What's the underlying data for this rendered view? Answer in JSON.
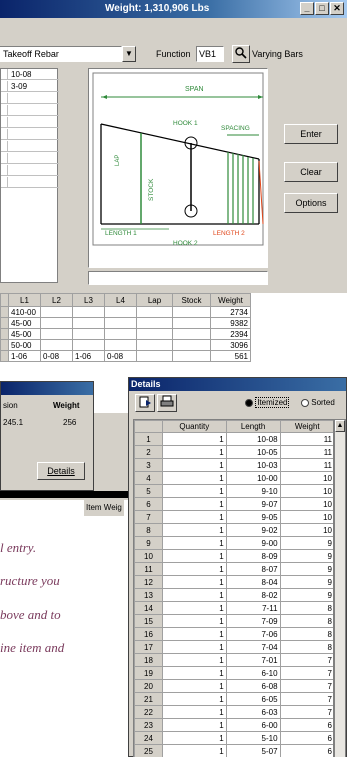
{
  "window": {
    "title": "Weight: 1,310,906 Lbs",
    "btn_min": "_",
    "btn_max": "□",
    "btn_close": "✕"
  },
  "toolbar": {
    "job_combo": "Takeoff Rebar",
    "function_label": "Function",
    "function_value": "VB1",
    "varying_label": "Varying Bars"
  },
  "left_list": [
    "10-08",
    "3-09",
    "",
    "",
    "",
    "",
    "",
    "",
    "",
    ""
  ],
  "diagram": {
    "span": "SPAN",
    "hook1": "HOOK 1",
    "hook2": "HOOK 2",
    "spacing": "SPACING",
    "lap": "LAP",
    "stock": "STOCK",
    "length1": "LENGTH 1",
    "length2": "LENGTH 2"
  },
  "side_buttons": {
    "enter": "Enter",
    "clear": "Clear",
    "options": "Options"
  },
  "grid": {
    "headers": [
      "L1",
      "L2",
      "L3",
      "L4",
      "Lap",
      "Stock",
      "Weight"
    ],
    "rows": [
      [
        "410-00",
        "",
        "",
        "",
        "",
        "",
        "2734"
      ],
      [
        "45-00",
        "",
        "",
        "",
        "",
        "",
        "9382"
      ],
      [
        "45-00",
        "",
        "",
        "",
        "",
        "",
        "2394"
      ],
      [
        "50-00",
        "",
        "",
        "",
        "",
        "",
        "3096"
      ],
      [
        "1-06",
        "0-08",
        "1-06",
        "0-08",
        "",
        "",
        "561"
      ]
    ]
  },
  "small_dialog": {
    "col1": "sion",
    "col2": "Weight",
    "val1": "245.1",
    "val2": "256",
    "details_button": "Details"
  },
  "item_weight_label": "Item Weig",
  "details": {
    "title": "Details",
    "radio_itemized": "Itemized",
    "radio_sorted": "Sorted",
    "headers": [
      "Quantity",
      "Length",
      "Weight"
    ],
    "rows": [
      [
        "1",
        "1",
        "10-08",
        "11"
      ],
      [
        "2",
        "1",
        "10-05",
        "11"
      ],
      [
        "3",
        "1",
        "10-03",
        "11"
      ],
      [
        "4",
        "1",
        "10-00",
        "10"
      ],
      [
        "5",
        "1",
        "9-10",
        "10"
      ],
      [
        "6",
        "1",
        "9-07",
        "10"
      ],
      [
        "7",
        "1",
        "9-05",
        "10"
      ],
      [
        "8",
        "1",
        "9-02",
        "10"
      ],
      [
        "9",
        "1",
        "9-00",
        "9"
      ],
      [
        "10",
        "1",
        "8-09",
        "9"
      ],
      [
        "11",
        "1",
        "8-07",
        "9"
      ],
      [
        "12",
        "1",
        "8-04",
        "9"
      ],
      [
        "13",
        "1",
        "8-02",
        "9"
      ],
      [
        "14",
        "1",
        "7-11",
        "8"
      ],
      [
        "15",
        "1",
        "7-09",
        "8"
      ],
      [
        "16",
        "1",
        "7-06",
        "8"
      ],
      [
        "17",
        "1",
        "7-04",
        "8"
      ],
      [
        "18",
        "1",
        "7-01",
        "7"
      ],
      [
        "19",
        "1",
        "6-10",
        "7"
      ],
      [
        "20",
        "1",
        "6-08",
        "7"
      ],
      [
        "21",
        "1",
        "6-05",
        "7"
      ],
      [
        "22",
        "1",
        "6-03",
        "7"
      ],
      [
        "23",
        "1",
        "6-00",
        "6"
      ],
      [
        "24",
        "1",
        "5-10",
        "6"
      ],
      [
        "25",
        "1",
        "5-07",
        "6"
      ]
    ]
  },
  "captions": [
    "l entry.",
    "ructure you",
    "bove and to",
    "ine item and"
  ]
}
